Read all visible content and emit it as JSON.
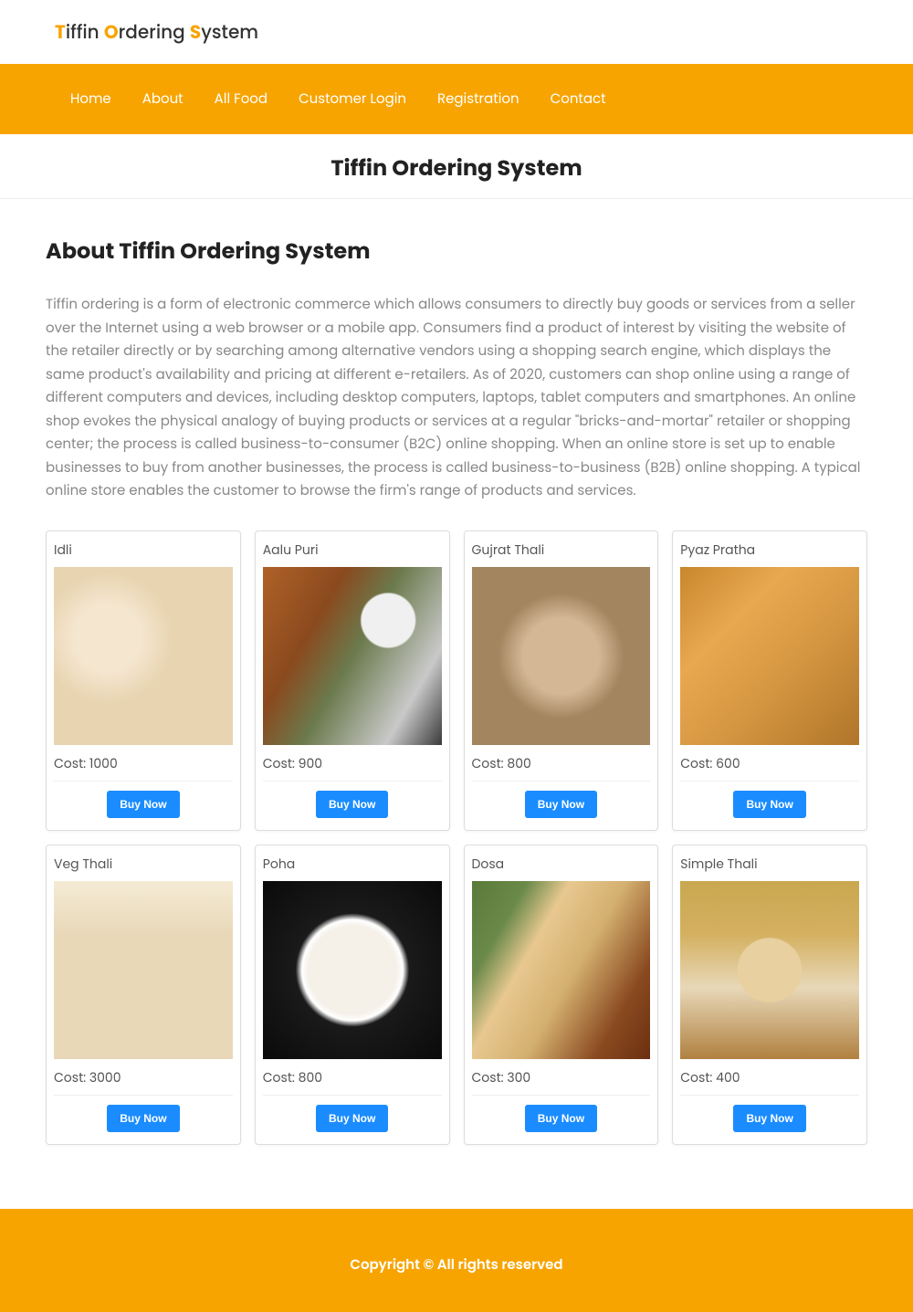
{
  "brand": {
    "parts": [
      {
        "accent": "T",
        "rest": "iffin "
      },
      {
        "accent": "O",
        "rest": "rdering "
      },
      {
        "accent": "S",
        "rest": "ystem"
      }
    ]
  },
  "nav": {
    "items": [
      "Home",
      "About",
      "All Food",
      "Customer Login",
      "Registration",
      "Contact"
    ]
  },
  "pageTitle": "Tiffin Ordering System",
  "about": {
    "heading": "About Tiffin Ordering System",
    "body": "Tiffin ordering is a form of electronic commerce which allows consumers to directly buy goods or services from a seller over the Internet using a web browser or a mobile app. Consumers find a product of interest by visiting the website of the retailer directly or by searching among alternative vendors using a shopping search engine, which displays the same product's availability and pricing at different e-retailers. As of 2020, customers can shop online using a range of different computers and devices, including desktop computers, laptops, tablet computers and smartphones. An online shop evokes the physical analogy of buying products or services at a regular \"bricks-and-mortar\" retailer or shopping center; the process is called business-to-consumer (B2C) online shopping. When an online store is set up to enable businesses to buy from another businesses, the process is called business-to-business (B2B) online shopping. A typical online store enables the customer to browse the firm's range of products and services."
  },
  "labels": {
    "costPrefix": "Cost: ",
    "buyNow": "Buy Now"
  },
  "foods": [
    {
      "name": "Idli",
      "cost": "1000",
      "imgClass": "img-idli"
    },
    {
      "name": "Aalu Puri",
      "cost": "900",
      "imgClass": "img-aalu"
    },
    {
      "name": "Gujrat Thali",
      "cost": "800",
      "imgClass": "img-gujrat"
    },
    {
      "name": "Pyaz Pratha",
      "cost": "600",
      "imgClass": "img-pyaz"
    },
    {
      "name": "Veg Thali",
      "cost": "3000",
      "imgClass": "img-vegthali"
    },
    {
      "name": "Poha",
      "cost": "800",
      "imgClass": "img-poha"
    },
    {
      "name": "Dosa",
      "cost": "300",
      "imgClass": "img-dosa"
    },
    {
      "name": "Simple Thali",
      "cost": "400",
      "imgClass": "img-simple"
    }
  ],
  "footer": {
    "text": "Copyright © All rights reserved"
  }
}
